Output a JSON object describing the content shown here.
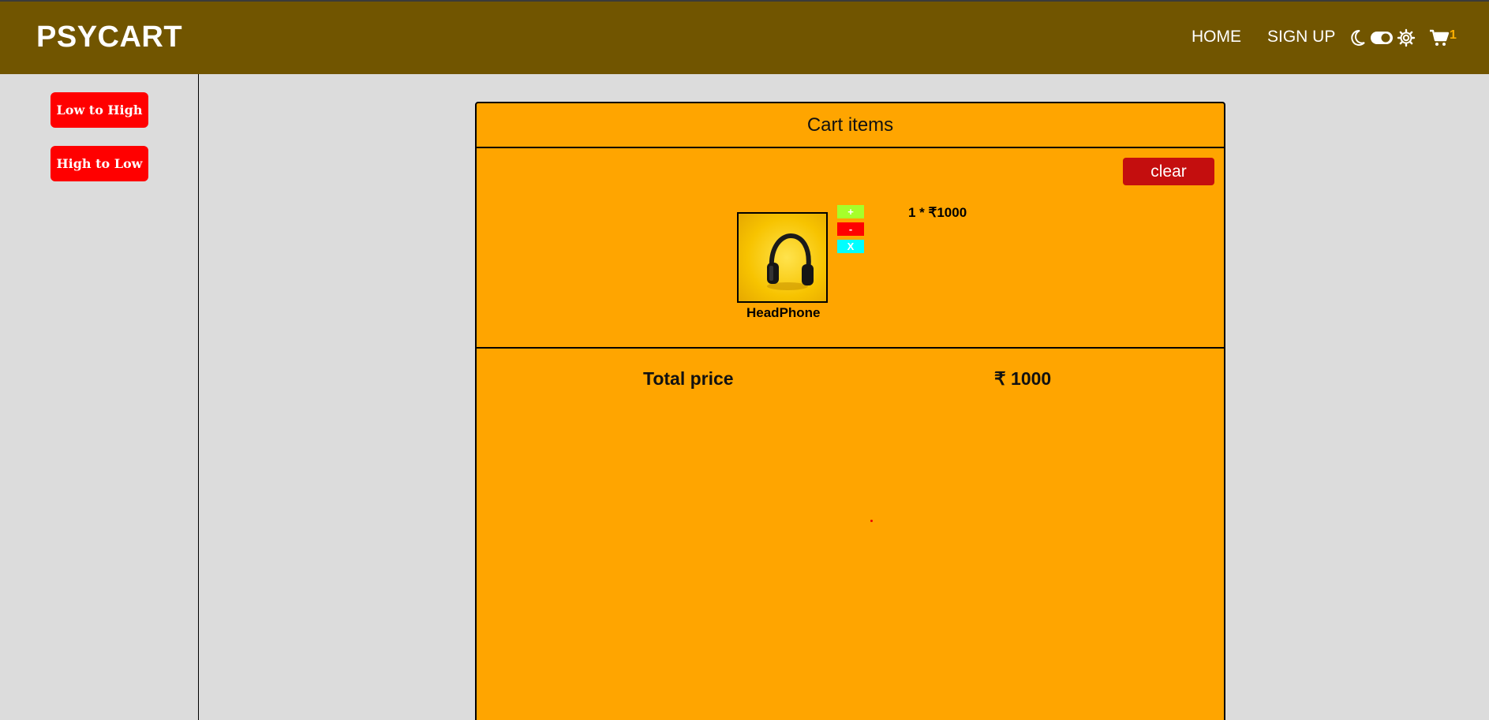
{
  "navbar": {
    "brand": "PSYCART",
    "links": {
      "home": "HOME",
      "signup": "SIGN UP"
    },
    "icons": [
      "moon-icon",
      "toggle-icon",
      "gear-icon",
      "cart-icon"
    ],
    "cart_count": "1",
    "colors": {
      "background": "#715500",
      "cart_count": "#ffb000"
    }
  },
  "sidebar": {
    "sort_low_high": "Low to High",
    "sort_high_low": "High to Low",
    "button_color": "#ff0000"
  },
  "cart": {
    "title": "Cart items",
    "clear_label": "clear",
    "items": [
      {
        "name": "HeadPhone",
        "price_line": "1 * ₹1000",
        "plus_label": "+",
        "minus_label": "-",
        "remove_label": "X"
      }
    ],
    "total_label": "Total price",
    "total_value": "₹ 1000",
    "colors": {
      "panel": "#ffa500",
      "clear": "#c40e0e",
      "plus": "#a6ff2a",
      "minus": "#ff0000",
      "remove": "#00ffff"
    }
  }
}
